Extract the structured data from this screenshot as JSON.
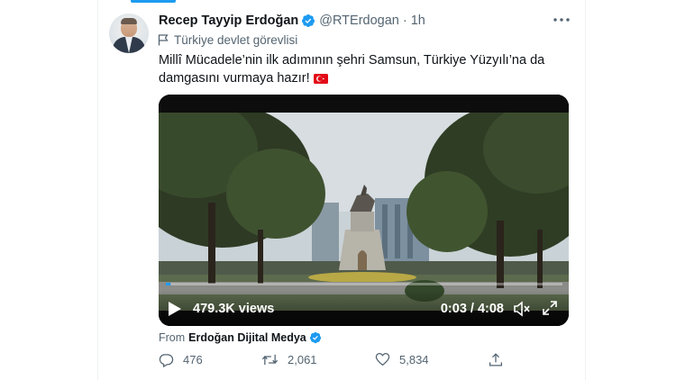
{
  "tweet": {
    "author": {
      "name": "Recep Tayyip Erdoğan",
      "handle": "@RTErdogan",
      "separator": "·",
      "time": "1h",
      "verified_color": "#1d9bf0"
    },
    "label": {
      "icon": "flag-icon",
      "text": "Türkiye devlet görevlisi"
    },
    "text_line1": "Millî Mücadele’nin ilk adımının şehri Samsun, Türkiye Yüzyılı’na da",
    "text_line2": "damgasını vurmaya hazır!",
    "flag_emoji": "turkey-flag",
    "video": {
      "views": "479.3K views",
      "current_time": "0:03",
      "duration": "4:08",
      "progress": 0.012,
      "time_readout": "0:03 / 4:08"
    },
    "source": {
      "prefix": "From",
      "name": "Erdoğan Dijital Medya"
    },
    "actions": {
      "replies": "476",
      "retweets": "2,061",
      "likes": "5,834"
    }
  },
  "colors": {
    "accent": "#1d9bf0",
    "text_primary": "#0f1419",
    "text_secondary": "#536471"
  }
}
